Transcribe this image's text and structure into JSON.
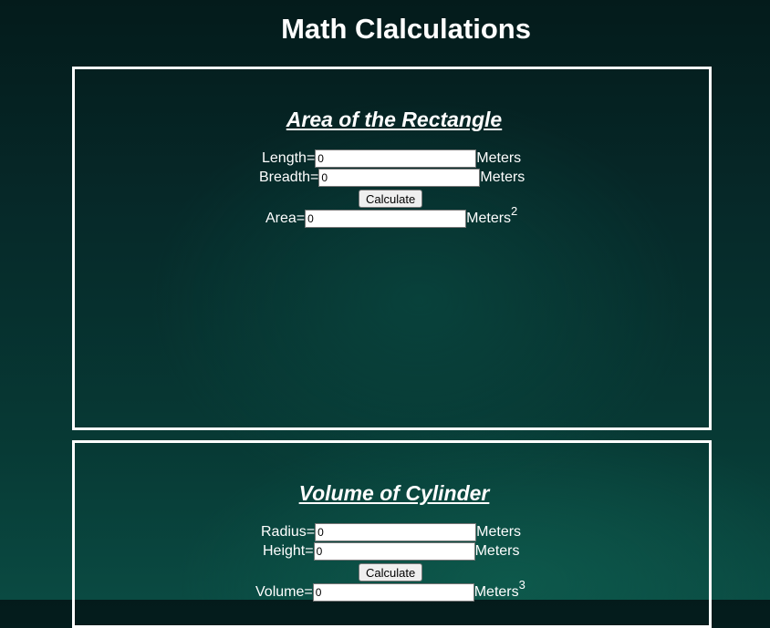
{
  "page": {
    "title": "Math Clalculations"
  },
  "rectangle": {
    "title": "Area of the Rectangle",
    "length_label": "Length=",
    "length_value": "0",
    "breadth_label": "Breadth=",
    "breadth_value": "0",
    "unit": "Meters",
    "button_label": "Calculate",
    "area_label": "Area=",
    "area_value": "0",
    "area_unit": "Meters",
    "area_exponent": "2"
  },
  "cylinder": {
    "title": "Volume of Cylinder",
    "radius_label": "Radius=",
    "radius_value": "0",
    "height_label": "Height=",
    "height_value": "0",
    "unit": "Meters",
    "button_label": "Calculate",
    "volume_label": "Volume=",
    "volume_value": "0",
    "volume_unit": "Meters",
    "volume_exponent": "3"
  },
  "colors": {
    "text": "#ffffff",
    "border": "#ffffff",
    "background": "#062929"
  }
}
